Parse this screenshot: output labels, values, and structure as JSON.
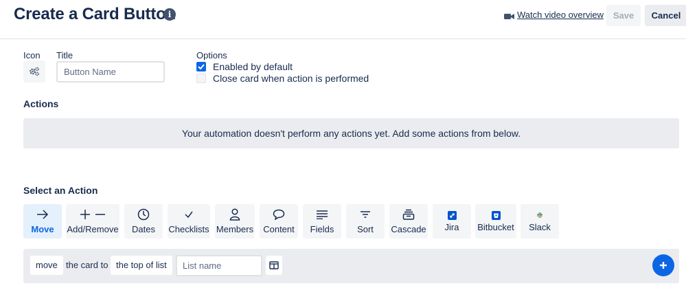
{
  "header": {
    "title": "Create a Card Button",
    "info_icon": "i",
    "video_link": "Watch video overview",
    "save_label": "Save",
    "cancel_label": "Cancel"
  },
  "form": {
    "icon_label": "Icon",
    "title_label": "Title",
    "title_placeholder": "Button Name",
    "title_value": "",
    "options_label": "Options",
    "options": [
      {
        "label": "Enabled by default",
        "checked": true
      },
      {
        "label": "Close card when action is performed",
        "checked": false
      }
    ]
  },
  "actions": {
    "heading": "Actions",
    "empty_message": "Your automation doesn't perform any actions yet. Add some actions from below."
  },
  "select_action": {
    "heading": "Select an Action",
    "tiles": [
      {
        "label": "Move",
        "icon": "arrow-right-icon",
        "active": true
      },
      {
        "label": "Add/Remove",
        "icon": "plus-minus-icon",
        "active": false
      },
      {
        "label": "Dates",
        "icon": "clock-icon",
        "active": false
      },
      {
        "label": "Checklists",
        "icon": "check-icon",
        "active": false
      },
      {
        "label": "Members",
        "icon": "person-icon",
        "active": false
      },
      {
        "label": "Content",
        "icon": "comment-icon",
        "active": false
      },
      {
        "label": "Fields",
        "icon": "lines-icon",
        "active": false
      },
      {
        "label": "Sort",
        "icon": "sort-icon",
        "active": false
      },
      {
        "label": "Cascade",
        "icon": "cascade-icon",
        "active": false
      },
      {
        "label": "Jira",
        "icon": "jira-icon",
        "active": false
      },
      {
        "label": "Bitbucket",
        "icon": "bitbucket-icon",
        "active": false
      },
      {
        "label": "Slack",
        "icon": "slack-icon",
        "active": false
      }
    ]
  },
  "builder": {
    "verb": "move",
    "connector": "the card to",
    "position": "the top of list",
    "list_placeholder": "List name",
    "list_value": ""
  },
  "colors": {
    "accent": "#0c66e4",
    "text": "#172b4d",
    "muted_bg": "#f4f5f7",
    "panel_bg": "#ebecf0",
    "active_tile_bg": "#e4f0fb"
  }
}
